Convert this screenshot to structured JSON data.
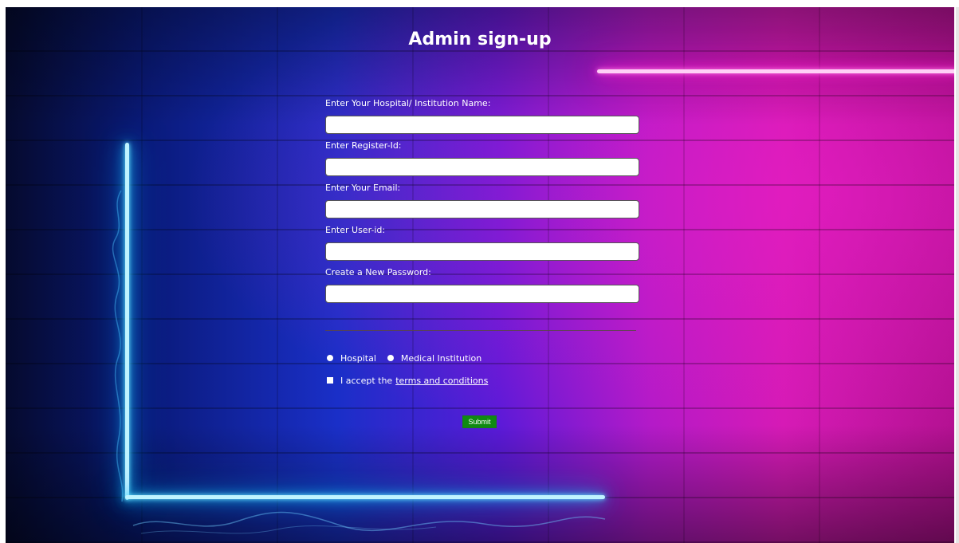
{
  "page": {
    "title": "Admin sign-up"
  },
  "form": {
    "fields": [
      {
        "label": "Enter Your Hospital/ Institution Name:",
        "value": "",
        "placeholder": ""
      },
      {
        "label": "Enter Register-Id:",
        "value": "",
        "placeholder": ""
      },
      {
        "label": "Enter Your Email:",
        "value": "",
        "placeholder": ""
      },
      {
        "label": "Enter User-id:",
        "value": "",
        "placeholder": ""
      },
      {
        "label": "Create a New Password:",
        "value": "",
        "placeholder": ""
      }
    ],
    "institution_type": {
      "options": [
        "Hospital",
        "Medical Institution"
      ]
    },
    "terms": {
      "prefix": "I accept the",
      "link_text": "terms and conditions"
    },
    "submit_label": "Submit"
  },
  "colors": {
    "submit_button": "#0f8a12",
    "neon_blue": "#22c8ff",
    "neon_pink": "#ff2fd8",
    "background_left": "#0a1a7a",
    "background_right": "#d41ab4"
  }
}
